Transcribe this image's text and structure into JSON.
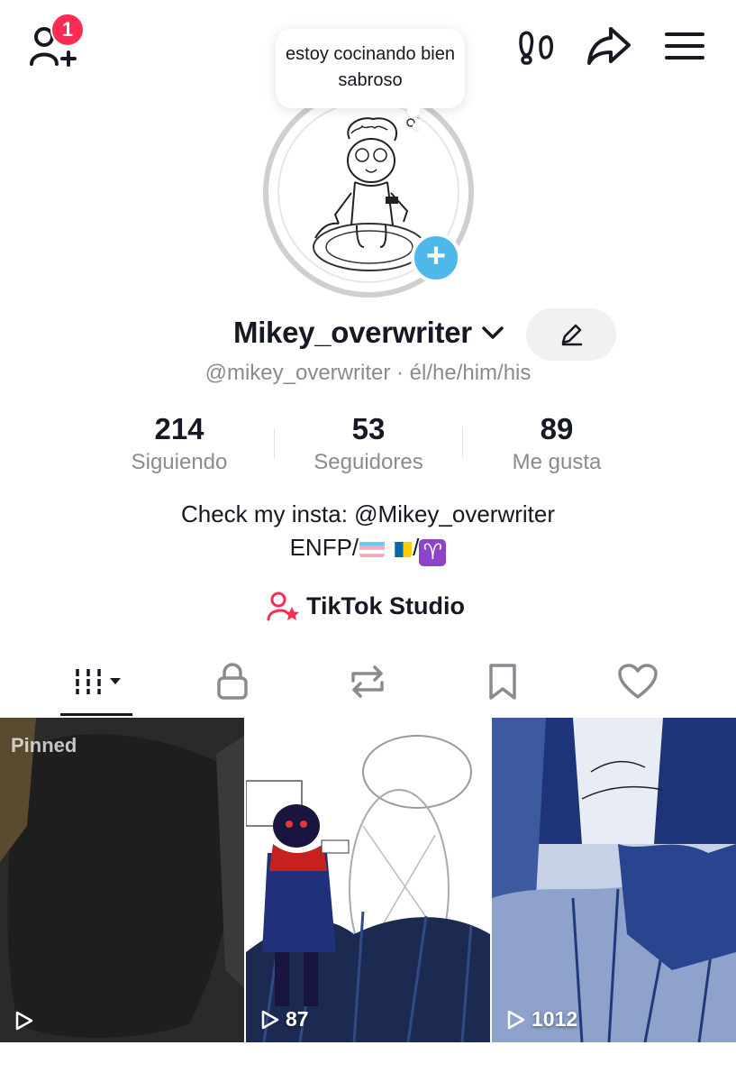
{
  "topbar": {
    "notification_count": "1",
    "icons": [
      "add-friend-icon",
      "footprints-icon",
      "share-icon",
      "menu-icon"
    ]
  },
  "profile": {
    "status_bubble": "estoy cocinando bien sabroso",
    "username": "Mikey_overwriter",
    "handle_line": "@mikey_overwriter · él/he/him/his"
  },
  "stats": [
    {
      "value": "214",
      "label": "Siguiendo"
    },
    {
      "value": "53",
      "label": "Seguidores"
    },
    {
      "value": "89",
      "label": "Me gusta"
    }
  ],
  "bio": {
    "line1": "Check my insta: @Mikey_overwriter",
    "line2_prefix": "ENFP/",
    "line2_sep": "/",
    "aries_symbol": "♈"
  },
  "studio": {
    "label": "TikTok Studio"
  },
  "tabs": [
    "videos-tab-icon",
    "private-lock-icon",
    "reposts-icon",
    "bookmark-icon",
    "likes-heart-icon"
  ],
  "videos": [
    {
      "views": "",
      "pinned_label": "Pinned"
    },
    {
      "views": "87"
    },
    {
      "views": "1012"
    }
  ],
  "colors": {
    "accent_red": "#fe2c55",
    "avatar_add_blue": "#4fb8ea",
    "muted_text": "#8a8b91"
  }
}
